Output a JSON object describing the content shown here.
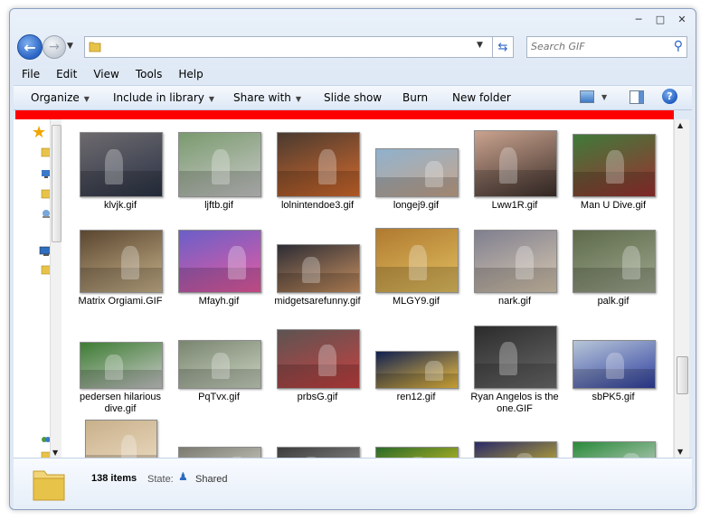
{
  "window": {
    "caption_buttons": [
      "minimize-icon",
      "maximize-icon",
      "close-icon"
    ]
  },
  "address": {
    "path_text": "",
    "search_placeholder": "Search GIF"
  },
  "menu": [
    "File",
    "Edit",
    "View",
    "Tools",
    "Help"
  ],
  "toolbar": {
    "organize": "Organize",
    "include_in_library": "Include in library",
    "share_with": "Share with",
    "slide_show": "Slide show",
    "burn": "Burn",
    "new_folder": "New folder"
  },
  "colors": {
    "banner": "#ff0000",
    "accent": "#2a64c5"
  },
  "files": [
    {
      "name": "klvjk.gif"
    },
    {
      "name": "ljftb.gif"
    },
    {
      "name": "lolnintendoe3.gif"
    },
    {
      "name": "longej9.gif"
    },
    {
      "name": "Lww1R.gif"
    },
    {
      "name": "Man U Dive.gif"
    },
    {
      "name": "Matrix Orgiami.GIF"
    },
    {
      "name": "Mfayh.gif"
    },
    {
      "name": "midgetsarefunny.gif"
    },
    {
      "name": "MLGY9.gif"
    },
    {
      "name": "nark.gif"
    },
    {
      "name": "palk.gif"
    },
    {
      "name": "pedersen hilarious dive.gif"
    },
    {
      "name": "PqTvx.gif"
    },
    {
      "name": "prbsG.gif"
    },
    {
      "name": "ren12.gif"
    },
    {
      "name": "Ryan Angelos is the one.GIF"
    },
    {
      "name": "sbPK5.gif"
    },
    {
      "name": ""
    },
    {
      "name": ""
    },
    {
      "name": ""
    },
    {
      "name": ""
    },
    {
      "name": ""
    },
    {
      "name": ""
    }
  ],
  "status": {
    "item_count": "138 items",
    "state_label": "State:",
    "state_value": "Shared"
  }
}
